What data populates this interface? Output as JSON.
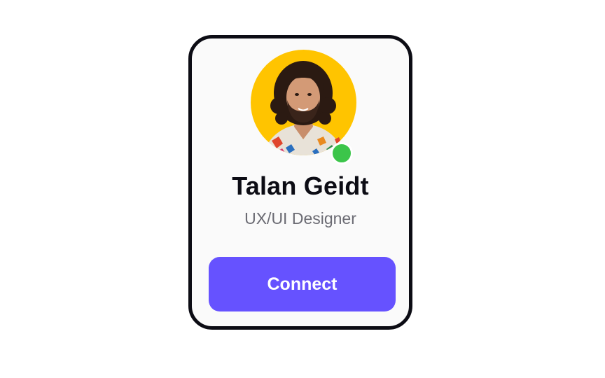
{
  "profile_card": {
    "name": "Talan Geidt",
    "role": "UX/UI Designer",
    "avatar_icon": "person-avatar",
    "status": "online",
    "connect_label": "Connect"
  },
  "colors": {
    "avatar_background": "#ffc400",
    "status_online": "#3cc54a",
    "button_accent": "#6652ff",
    "card_border": "#0c0c14"
  }
}
